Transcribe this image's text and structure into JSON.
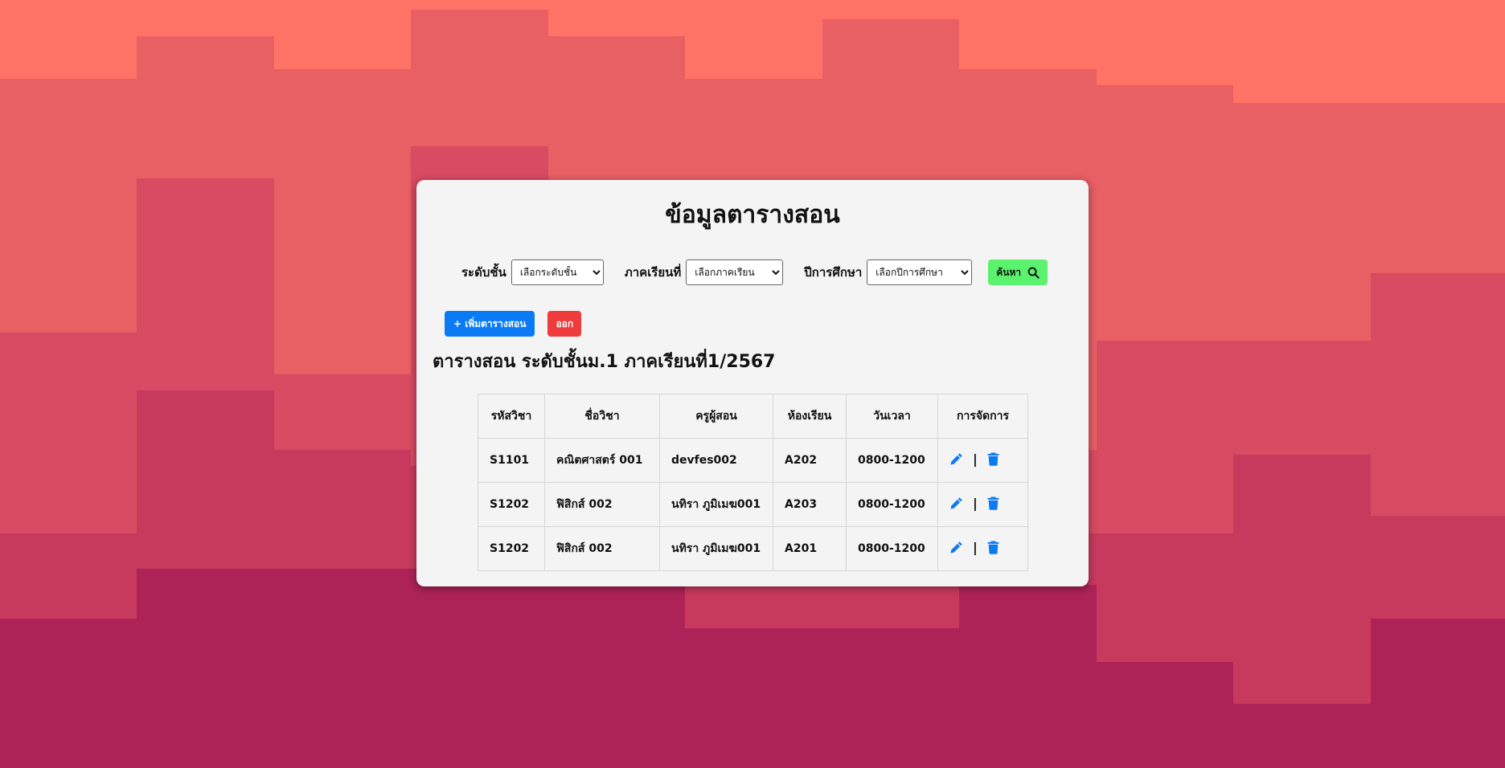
{
  "page": {
    "title": "ข้อมูลตารางสอน",
    "subtitle": "ตารางสอน ระดับชั้นม.1 ภาคเรียนที่1/2567"
  },
  "filters": {
    "level_label": "ระดับชั้น",
    "level_value": "เลือกระดับชั้น",
    "term_label": "ภาคเรียนที่",
    "term_value": "เลือกภาคเรียน",
    "year_label": "ปีการศึกษา",
    "year_value": "เลือกปีการศึกษา",
    "search_label": "ค้นหา",
    "search_icon": "search-icon"
  },
  "actions": {
    "add_label": "+ เพิ่มตารางสอน",
    "logout_label": "ออก"
  },
  "table": {
    "headers": [
      "รหัสวิชา",
      "ชื่อวิชา",
      "ครูผู้สอน",
      "ห้องเรียน",
      "วันเวลา",
      "การจัดการ"
    ],
    "rows": [
      [
        "S1101",
        "คณิตศาสตร์ 001",
        "devfes002",
        "A202",
        "0800-1200"
      ],
      [
        "S1202",
        "ฟิสิกส์ 002",
        "นทิรา ภูมิเมฆ001",
        "A203",
        "0800-1200"
      ],
      [
        "S1202",
        "ฟิสิกส์ 002",
        "นทิรา ภูมิเมฆ001",
        "A201",
        "0800-1200"
      ]
    ],
    "action_separator": "|",
    "edit_icon": "pencil-icon",
    "delete_icon": "trash-icon"
  },
  "colors": {
    "add_button": "#0b7bf5",
    "logout_button": "#ef3b3b",
    "search_button": "#5bf26d",
    "action_icons": "#0b7bf5"
  }
}
